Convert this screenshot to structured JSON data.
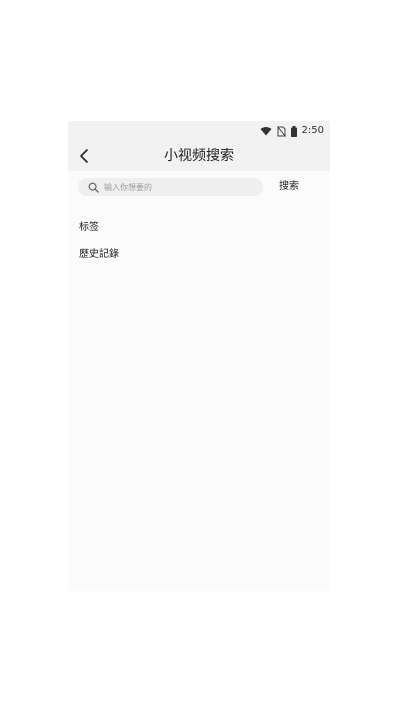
{
  "status_bar": {
    "time": "2:50",
    "icons": [
      "wifi-icon",
      "no-sim-icon",
      "battery-icon"
    ]
  },
  "header": {
    "title": "小视频搜索",
    "back_icon": "chevron-left-icon"
  },
  "search": {
    "placeholder": "输入你想要的",
    "value": "",
    "button_label": "搜索",
    "icon": "search-icon"
  },
  "sections": {
    "tags_label": "标签",
    "history_label": "歷史記錄"
  },
  "colors": {
    "header_bg": "#f2f2f2",
    "page_bg": "#fbfbfb",
    "search_bg": "#efefef",
    "text": "#222222"
  }
}
